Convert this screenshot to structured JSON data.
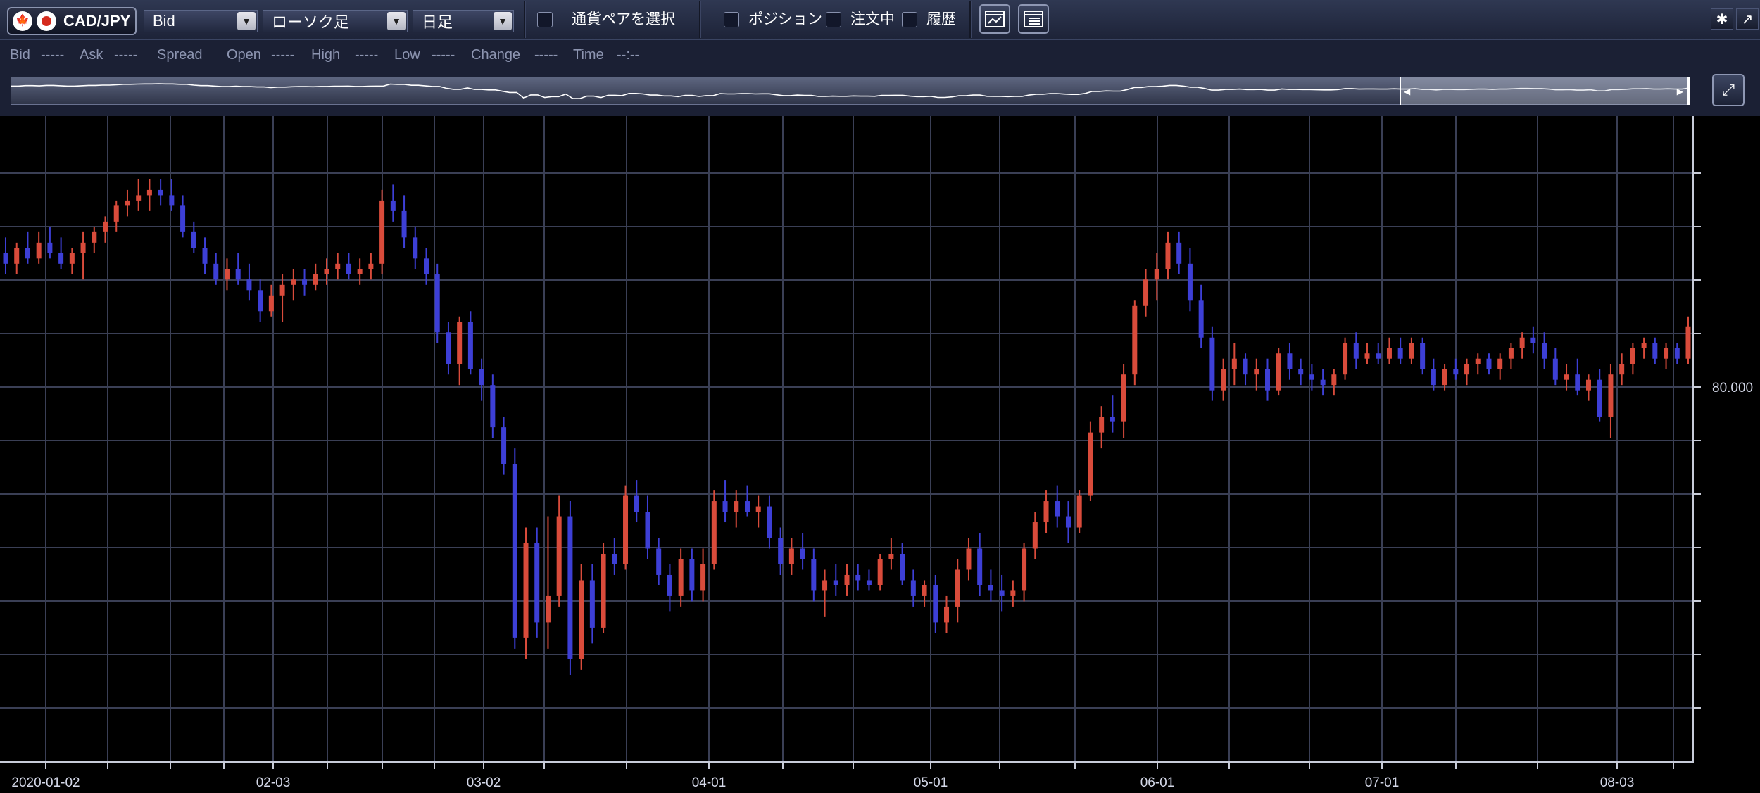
{
  "toolbar": {
    "pair_label": "CAD/JPY",
    "price_type": "Bid",
    "chart_type": "ローソク足",
    "timeframe": "日足",
    "select_pair_label": "通貨ペアを選択",
    "position_label": "ポジション",
    "orders_label": "注文中",
    "history_label": "履歴",
    "icons": [
      "canada-flag-icon",
      "japan-flag-icon",
      "chevron-down-icon",
      "chart-window-icon",
      "list-window-icon",
      "gear-icon",
      "expand-icon",
      "zoom-icon"
    ]
  },
  "quote_bar": {
    "bid_label": "Bid",
    "bid_value": "-----",
    "ask_label": "Ask",
    "ask_value": "-----",
    "spread_label": "Spread",
    "open_label": "Open",
    "open_value": "-----",
    "high_label": "High",
    "high_value": "-----",
    "low_label": "Low",
    "low_value": "-----",
    "change_label": "Change",
    "change_value": "-----",
    "time_label": "Time",
    "time_value": "--:--"
  },
  "colors": {
    "up_candle": "#d94b3b",
    "down_candle": "#3d3fd6",
    "grid": "#3a3f55",
    "background": "#000000"
  },
  "chart_data": {
    "type": "candlestick",
    "symbol": "CAD/JPY",
    "timeframe": "daily",
    "x_tick_labels": [
      "2020-01-02",
      "02-03",
      "03-02",
      "04-01",
      "05-01",
      "06-01",
      "07-01",
      "08-03"
    ],
    "y_tick_label": "80.000",
    "ylim": [
      71.85,
      84.1
    ],
    "grid": true,
    "candles": [
      [
        81.5,
        81.8,
        81.1,
        81.3
      ],
      [
        81.3,
        81.7,
        81.1,
        81.6
      ],
      [
        81.6,
        81.9,
        81.3,
        81.4
      ],
      [
        81.4,
        81.9,
        81.3,
        81.7
      ],
      [
        81.7,
        82.0,
        81.4,
        81.5
      ],
      [
        81.5,
        81.8,
        81.2,
        81.3
      ],
      [
        81.3,
        81.6,
        81.1,
        81.5
      ],
      [
        81.5,
        81.9,
        81.0,
        81.7
      ],
      [
        81.7,
        82.0,
        81.5,
        81.9
      ],
      [
        81.9,
        82.2,
        81.7,
        82.1
      ],
      [
        82.1,
        82.5,
        81.9,
        82.4
      ],
      [
        82.4,
        82.7,
        82.2,
        82.5
      ],
      [
        82.5,
        82.9,
        82.3,
        82.6
      ],
      [
        82.6,
        82.9,
        82.3,
        82.7
      ],
      [
        82.7,
        82.9,
        82.4,
        82.6
      ],
      [
        82.6,
        82.9,
        82.3,
        82.4
      ],
      [
        82.4,
        82.6,
        81.8,
        81.9
      ],
      [
        81.9,
        82.1,
        81.5,
        81.6
      ],
      [
        81.6,
        81.8,
        81.1,
        81.3
      ],
      [
        81.3,
        81.5,
        80.9,
        81.0
      ],
      [
        81.0,
        81.4,
        80.8,
        81.2
      ],
      [
        81.2,
        81.5,
        80.9,
        81.0
      ],
      [
        81.0,
        81.3,
        80.6,
        80.8
      ],
      [
        80.8,
        81.0,
        80.2,
        80.4
      ],
      [
        80.4,
        80.9,
        80.3,
        80.7
      ],
      [
        80.7,
        81.1,
        80.2,
        80.9
      ],
      [
        80.9,
        81.2,
        80.6,
        81.0
      ],
      [
        81.0,
        81.2,
        80.7,
        80.9
      ],
      [
        80.9,
        81.3,
        80.8,
        81.1
      ],
      [
        81.1,
        81.4,
        80.9,
        81.2
      ],
      [
        81.2,
        81.5,
        81.0,
        81.3
      ],
      [
        81.3,
        81.5,
        81.0,
        81.1
      ],
      [
        81.1,
        81.4,
        80.9,
        81.2
      ],
      [
        81.2,
        81.5,
        81.0,
        81.3
      ],
      [
        81.3,
        82.7,
        81.1,
        82.5
      ],
      [
        82.5,
        82.8,
        82.1,
        82.3
      ],
      [
        82.3,
        82.6,
        81.6,
        81.8
      ],
      [
        81.8,
        82.0,
        81.2,
        81.4
      ],
      [
        81.4,
        81.6,
        80.9,
        81.1
      ],
      [
        81.1,
        81.3,
        79.8,
        80.0
      ],
      [
        80.0,
        80.2,
        79.2,
        79.4
      ],
      [
        79.4,
        80.3,
        79.0,
        80.2
      ],
      [
        80.2,
        80.4,
        79.2,
        79.3
      ],
      [
        79.3,
        79.5,
        78.7,
        79.0
      ],
      [
        79.0,
        79.2,
        78.0,
        78.2
      ],
      [
        78.2,
        78.4,
        77.3,
        77.5
      ],
      [
        77.5,
        77.8,
        74.0,
        74.2
      ],
      [
        74.2,
        76.3,
        73.8,
        76.0
      ],
      [
        76.0,
        76.3,
        74.2,
        74.5
      ],
      [
        74.5,
        76.5,
        74.0,
        75.0
      ],
      [
        75.0,
        76.9,
        74.8,
        76.5
      ],
      [
        76.5,
        76.8,
        73.5,
        73.8
      ],
      [
        73.8,
        75.6,
        73.6,
        75.3
      ],
      [
        75.3,
        75.6,
        74.1,
        74.4
      ],
      [
        74.4,
        76.0,
        74.3,
        75.8
      ],
      [
        75.8,
        76.1,
        75.4,
        75.6
      ],
      [
        75.6,
        77.1,
        75.5,
        76.9
      ],
      [
        76.9,
        77.2,
        76.4,
        76.6
      ],
      [
        76.6,
        76.9,
        75.7,
        75.9
      ],
      [
        75.9,
        76.1,
        75.2,
        75.4
      ],
      [
        75.4,
        75.6,
        74.7,
        75.0
      ],
      [
        75.0,
        75.9,
        74.8,
        75.7
      ],
      [
        75.7,
        75.9,
        74.9,
        75.1
      ],
      [
        75.1,
        75.9,
        74.9,
        75.6
      ],
      [
        75.6,
        77.0,
        75.5,
        76.8
      ],
      [
        76.8,
        77.2,
        76.4,
        76.6
      ],
      [
        76.6,
        77.0,
        76.3,
        76.8
      ],
      [
        76.8,
        77.1,
        76.5,
        76.6
      ],
      [
        76.6,
        76.9,
        76.3,
        76.7
      ],
      [
        76.7,
        76.9,
        75.9,
        76.1
      ],
      [
        76.1,
        76.3,
        75.4,
        75.6
      ],
      [
        75.6,
        76.1,
        75.4,
        75.9
      ],
      [
        75.9,
        76.2,
        75.5,
        75.7
      ],
      [
        75.7,
        75.9,
        74.9,
        75.1
      ],
      [
        75.1,
        75.5,
        74.6,
        75.3
      ],
      [
        75.3,
        75.6,
        75.0,
        75.2
      ],
      [
        75.2,
        75.6,
        75.0,
        75.4
      ],
      [
        75.4,
        75.6,
        75.1,
        75.3
      ],
      [
        75.3,
        75.5,
        75.1,
        75.2
      ],
      [
        75.2,
        75.8,
        75.1,
        75.7
      ],
      [
        75.7,
        76.1,
        75.5,
        75.8
      ],
      [
        75.8,
        76.0,
        75.2,
        75.3
      ],
      [
        75.3,
        75.5,
        74.8,
        75.0
      ],
      [
        75.0,
        75.3,
        74.8,
        75.2
      ],
      [
        75.2,
        75.4,
        74.3,
        74.5
      ],
      [
        74.5,
        75.0,
        74.3,
        74.8
      ],
      [
        74.8,
        75.7,
        74.5,
        75.5
      ],
      [
        75.5,
        76.1,
        75.3,
        75.9
      ],
      [
        75.9,
        76.2,
        75.0,
        75.2
      ],
      [
        75.2,
        75.5,
        74.9,
        75.1
      ],
      [
        75.1,
        75.4,
        74.7,
        75.0
      ],
      [
        75.0,
        75.3,
        74.8,
        75.1
      ],
      [
        75.1,
        76.0,
        74.9,
        75.9
      ],
      [
        75.9,
        76.6,
        75.7,
        76.4
      ],
      [
        76.4,
        77.0,
        76.2,
        76.8
      ],
      [
        76.8,
        77.1,
        76.3,
        76.5
      ],
      [
        76.5,
        76.8,
        76.0,
        76.3
      ],
      [
        76.3,
        77.0,
        76.2,
        76.9
      ],
      [
        76.9,
        78.3,
        76.8,
        78.1
      ],
      [
        78.1,
        78.6,
        77.8,
        78.4
      ],
      [
        78.4,
        78.8,
        78.1,
        78.3
      ],
      [
        78.3,
        79.4,
        78.0,
        79.2
      ],
      [
        79.2,
        80.6,
        79.0,
        80.5
      ],
      [
        80.5,
        81.2,
        80.3,
        81.0
      ],
      [
        81.0,
        81.5,
        80.6,
        81.2
      ],
      [
        81.2,
        81.9,
        81.0,
        81.7
      ],
      [
        81.7,
        81.9,
        81.1,
        81.3
      ],
      [
        81.3,
        81.6,
        80.4,
        80.6
      ],
      [
        80.6,
        80.9,
        79.7,
        79.9
      ],
      [
        79.9,
        80.1,
        78.7,
        78.9
      ],
      [
        78.9,
        79.5,
        78.7,
        79.3
      ],
      [
        79.3,
        79.8,
        79.0,
        79.5
      ],
      [
        79.5,
        79.6,
        79.0,
        79.2
      ],
      [
        79.2,
        79.5,
        78.9,
        79.3
      ],
      [
        79.3,
        79.5,
        78.7,
        78.9
      ],
      [
        78.9,
        79.7,
        78.8,
        79.6
      ],
      [
        79.6,
        79.8,
        79.1,
        79.3
      ],
      [
        79.3,
        79.5,
        79.0,
        79.2
      ],
      [
        79.2,
        79.4,
        78.9,
        79.1
      ],
      [
        79.1,
        79.3,
        78.8,
        79.0
      ],
      [
        79.0,
        79.3,
        78.8,
        79.2
      ],
      [
        79.2,
        79.9,
        79.1,
        79.8
      ],
      [
        79.8,
        80.0,
        79.3,
        79.5
      ],
      [
        79.5,
        79.8,
        79.4,
        79.6
      ],
      [
        79.6,
        79.8,
        79.4,
        79.5
      ],
      [
        79.5,
        79.9,
        79.4,
        79.7
      ],
      [
        79.7,
        79.9,
        79.4,
        79.5
      ],
      [
        79.5,
        79.9,
        79.4,
        79.8
      ],
      [
        79.8,
        79.9,
        79.2,
        79.3
      ],
      [
        79.3,
        79.5,
        78.9,
        79.0
      ],
      [
        79.0,
        79.4,
        78.9,
        79.3
      ],
      [
        79.3,
        79.5,
        79.1,
        79.2
      ],
      [
        79.2,
        79.5,
        79.0,
        79.4
      ],
      [
        79.4,
        79.6,
        79.2,
        79.5
      ],
      [
        79.5,
        79.6,
        79.2,
        79.3
      ],
      [
        79.3,
        79.6,
        79.1,
        79.5
      ],
      [
        79.5,
        79.8,
        79.3,
        79.7
      ],
      [
        79.7,
        80.0,
        79.5,
        79.9
      ],
      [
        79.9,
        80.1,
        79.6,
        79.8
      ],
      [
        79.8,
        80.0,
        79.3,
        79.5
      ],
      [
        79.5,
        79.7,
        79.0,
        79.1
      ],
      [
        79.1,
        79.4,
        78.9,
        79.2
      ],
      [
        79.2,
        79.5,
        78.8,
        78.9
      ],
      [
        78.9,
        79.2,
        78.7,
        79.1
      ],
      [
        79.1,
        79.3,
        78.3,
        78.4
      ],
      [
        78.4,
        79.4,
        78.0,
        79.2
      ],
      [
        79.2,
        79.6,
        79.0,
        79.4
      ],
      [
        79.4,
        79.8,
        79.2,
        79.7
      ],
      [
        79.7,
        79.9,
        79.5,
        79.8
      ],
      [
        79.8,
        79.9,
        79.4,
        79.5
      ],
      [
        79.5,
        79.8,
        79.3,
        79.7
      ],
      [
        79.7,
        79.8,
        79.4,
        79.5
      ],
      [
        79.5,
        80.3,
        79.4,
        80.1
      ]
    ]
  }
}
